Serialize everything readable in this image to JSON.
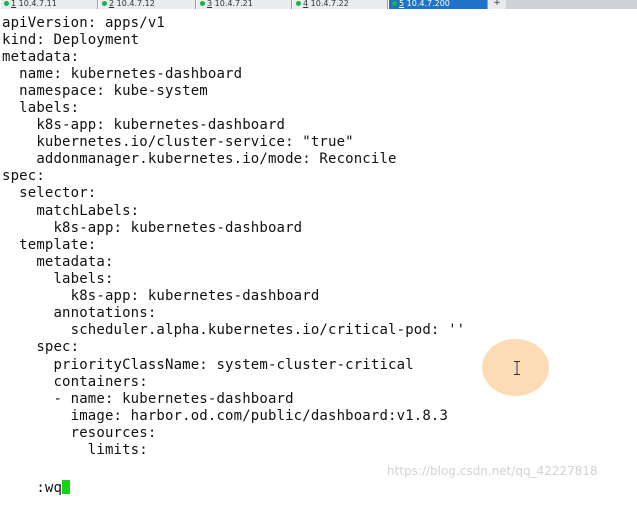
{
  "tabs": [
    {
      "num": "1",
      "label": "10.4.7.11",
      "active": false
    },
    {
      "num": "2",
      "label": "10.4.7.12",
      "active": false
    },
    {
      "num": "3",
      "label": "10.4.7.21",
      "active": false
    },
    {
      "num": "4",
      "label": "10.4.7.22",
      "active": false
    },
    {
      "num": "5",
      "label": "10.4.7.200",
      "active": true
    }
  ],
  "new_tab_label": "+",
  "lines": [
    "apiVersion: apps/v1",
    "kind: Deployment",
    "metadata:",
    "  name: kubernetes-dashboard",
    "  namespace: kube-system",
    "  labels:",
    "    k8s-app: kubernetes-dashboard",
    "    kubernetes.io/cluster-service: \"true\"",
    "    addonmanager.kubernetes.io/mode: Reconcile",
    "spec:",
    "  selector:",
    "    matchLabels:",
    "      k8s-app: kubernetes-dashboard",
    "  template:",
    "    metadata:",
    "      labels:",
    "        k8s-app: kubernetes-dashboard",
    "      annotations:",
    "        scheduler.alpha.kubernetes.io/critical-pod: ''",
    "    spec:",
    "      priorityClassName: system-cluster-critical",
    "      containers:",
    "      - name: kubernetes-dashboard",
    "        image: harbor.od.com/public/dashboard:v1.8.3",
    "        resources:",
    "          limits:"
  ],
  "command_line": ":wq",
  "watermark": "https://blog.csdn.net/qq_42227818",
  "colors": {
    "cursor": "#17d317",
    "active_tab": "#1e73c8",
    "tab_status_dot": "#19b34a",
    "click_marker": "#fabe78"
  }
}
